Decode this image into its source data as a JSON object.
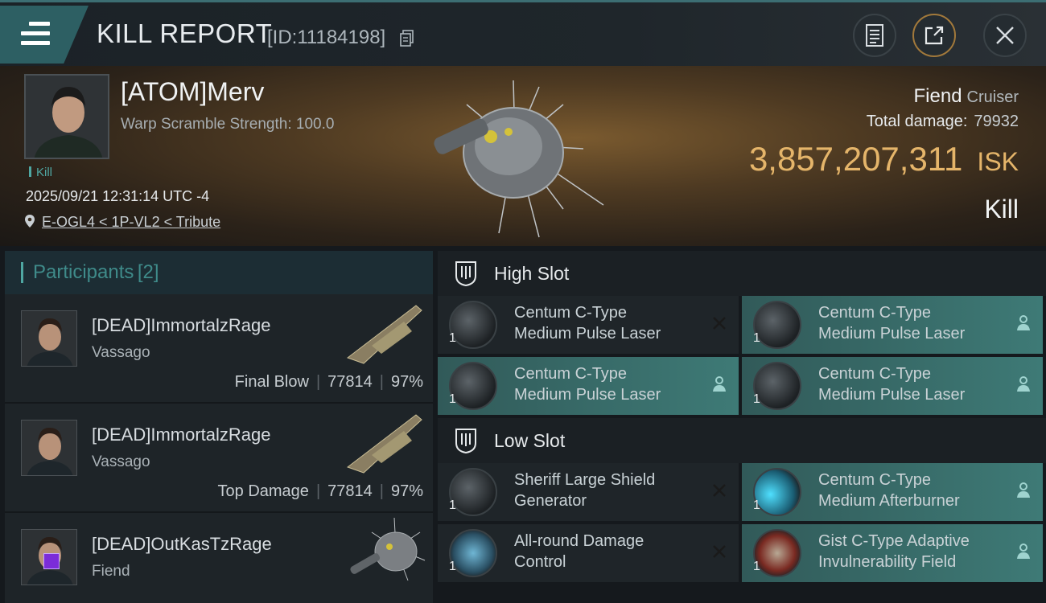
{
  "header": {
    "title": "KILL REPORT",
    "report_id": "[ID:11184198]"
  },
  "victim": {
    "name": "[ATOM]Merv",
    "warp_scramble": "Warp Scramble Strength: 100.0",
    "tag": "Kill",
    "datetime": "2025/09/21 12:31:14 UTC -4",
    "location": "E-OGL4 < 1P-VL2 < Tribute",
    "ship_name": "Fiend",
    "ship_class": "Cruiser",
    "total_damage_label": "Total damage:",
    "total_damage_value": "79932",
    "isk_value": "3,857,207,311",
    "isk_unit": "ISK",
    "result": "Kill"
  },
  "participants": {
    "title": "Participants",
    "count": "[2]",
    "rows": [
      {
        "name": "[DEAD]ImmortalzRage",
        "ship": "Vassago",
        "role": "Final Blow",
        "damage": "77814",
        "percent": "97%"
      },
      {
        "name": "[DEAD]ImmortalzRage",
        "ship": "Vassago",
        "role": "Top Damage",
        "damage": "77814",
        "percent": "97%"
      },
      {
        "name": "[DEAD]OutKasTzRage",
        "ship": "Fiend"
      }
    ]
  },
  "slots": {
    "high": {
      "label": "High Slot",
      "items": [
        {
          "name_line1": "Centum C-Type",
          "name_line2": "Medium Pulse Laser",
          "qty": "1",
          "status": "destroyed"
        },
        {
          "name_line1": "Centum C-Type",
          "name_line2": "Medium Pulse Laser",
          "qty": "1",
          "status": "dropped"
        },
        {
          "name_line1": "Centum C-Type",
          "name_line2": "Medium Pulse Laser",
          "qty": "1",
          "status": "dropped"
        },
        {
          "name_line1": "Centum C-Type",
          "name_line2": "Medium Pulse Laser",
          "qty": "1",
          "status": "dropped"
        }
      ]
    },
    "low": {
      "label": "Low Slot",
      "items": [
        {
          "name_line1": "Sheriff Large Shield",
          "name_line2": "Generator",
          "qty": "1",
          "status": "destroyed"
        },
        {
          "name_line1": "Centum C-Type",
          "name_line2": "Medium Afterburner",
          "qty": "1",
          "status": "dropped"
        },
        {
          "name_line1": "All-round Damage",
          "name_line2": "Control",
          "qty": "1",
          "status": "destroyed"
        },
        {
          "name_line1": "Gist C-Type Adaptive",
          "name_line2": "Invulnerability Field",
          "qty": "1",
          "status": "dropped"
        }
      ]
    }
  },
  "colors": {
    "accent_teal": "#4fa7a2",
    "isk_gold": "#e5b56a",
    "fitted_bg": "#3e7a76"
  }
}
